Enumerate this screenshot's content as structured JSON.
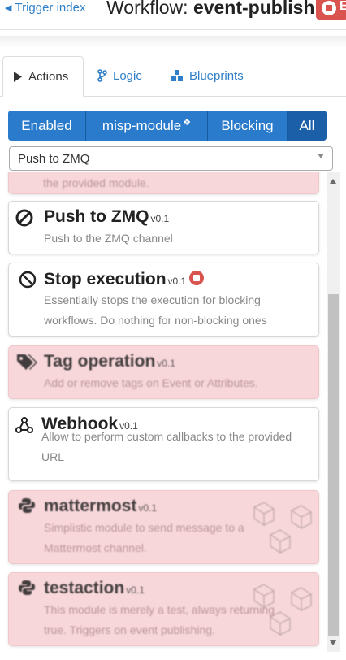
{
  "header": {
    "back_label": "Trigger index",
    "title_prefix": "Workflow: ",
    "title_name": "event-publish",
    "stop_label": "E"
  },
  "tabs": [
    {
      "label": "Actions",
      "icon": "play-icon"
    },
    {
      "label": "Logic",
      "icon": "branch-icon"
    },
    {
      "label": "Blueprints",
      "icon": "cubes-icon"
    }
  ],
  "filters": {
    "enabled": "Enabled",
    "misp_module": "misp-module",
    "blocking": "Blocking",
    "all": "All"
  },
  "select": {
    "value": "Push to ZMQ"
  },
  "modules": [
    {
      "name": "",
      "version": "",
      "description": "the provided module.",
      "enabled": false
    },
    {
      "name": "Push to ZMQ",
      "version": "v0.1",
      "description": "Push to the ZMQ channel",
      "icon": "ban-icon",
      "enabled": true
    },
    {
      "name": "Stop execution",
      "version": "v0.1",
      "description": "Essentially stops the execution for blocking workflows. Do nothing for non-blocking ones",
      "icon": "ban-icon",
      "blocking": true,
      "enabled": true
    },
    {
      "name": "Tag operation",
      "version": "v0.1",
      "description": "Add or remove tags on Event or Attributes.",
      "icon": "tags-icon",
      "enabled": false
    },
    {
      "name": "Webhook",
      "version": "v0.1",
      "description": "Allow to perform custom callbacks to the provided URL",
      "icon": "webhook-icon",
      "enabled": true
    },
    {
      "name": "mattermost",
      "version": "v0.1",
      "description": "Simplistic module to send message to a Mattermost channel.",
      "icon": "python-icon",
      "enabled": false
    },
    {
      "name": "testaction",
      "version": "v0.1",
      "description": "This module is merely a test, always returning true. Triggers on event publishing.",
      "icon": "python-icon",
      "enabled": false
    }
  ],
  "colors": {
    "primary": "#2b7bcc",
    "danger": "#d9534f",
    "disabled_bg": "#f8d7da",
    "link": "#2f7fc8"
  }
}
